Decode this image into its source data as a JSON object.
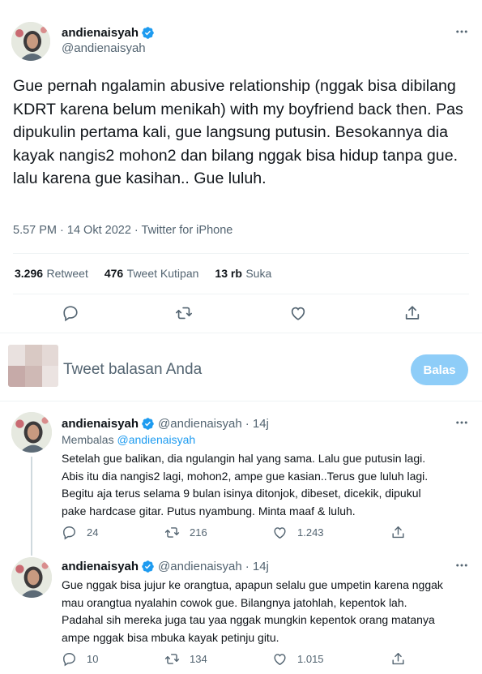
{
  "main_tweet": {
    "display_name": "andienaisyah",
    "username": "@andienaisyah",
    "text": "Gue pernah ngalamin abusive relationship (nggak bisa dibilang KDRT karena belum menikah) with my boyfriend back then. Pas dipukulin pertama kali, gue langsung putusin. Besokannya dia kayak nangis2 mohon2 dan bilang nggak bisa hidup tanpa gue. lalu karena gue kasihan.. Gue luluh.",
    "meta": "5.57 PM · 14 Okt 2022 · Twitter for iPhone",
    "stats": {
      "retweets_count": "3.296",
      "retweets_label": "Retweet",
      "quotes_count": "476",
      "quotes_label": "Tweet Kutipan",
      "likes_count": "13 rb",
      "likes_label": "Suka"
    }
  },
  "composer": {
    "placeholder": "Tweet balasan Anda",
    "button_label": "Balas"
  },
  "replies": [
    {
      "display_name": "andienaisyah",
      "username": "@andienaisyah",
      "time": "· 14j",
      "replying_prefix": "Membalas",
      "replying_to": "@andienaisyah",
      "text": "Setelah gue balikan, dia ngulangin hal yang sama. Lalu gue putusin lagi.\nAbis itu dia nangis2 lagi, mohon2, ampe gue kasian..Terus gue luluh lagi.\nBegitu aja terus selama 9 bulan isinya ditonjok, dibeset, dicekik, dipukul\npake hardcase gitar. Putus nyambung. Minta maaf & luluh.",
      "reply_count": "24",
      "retweet_count": "216",
      "like_count": "1.243"
    },
    {
      "display_name": "andienaisyah",
      "username": "@andienaisyah",
      "time": "· 14j",
      "text": "Gue nggak bisa jujur ke orangtua, apapun selalu gue umpetin karena nggak\nmau orangtua nyalahin cowok gue. Bilangnya jatohlah, kepentok lah.\nPadahal sih mereka juga tau yaa nggak mungkin kepentok orang matanya\nampe nggak bisa mbuka kayak petinju gitu.",
      "reply_count": "10",
      "retweet_count": "134",
      "like_count": "1.015"
    }
  ],
  "colors": {
    "accent": "#1d9bf0",
    "button_disabled": "#8ecdf8",
    "text_secondary": "#536471",
    "divider": "#eff3f4"
  }
}
